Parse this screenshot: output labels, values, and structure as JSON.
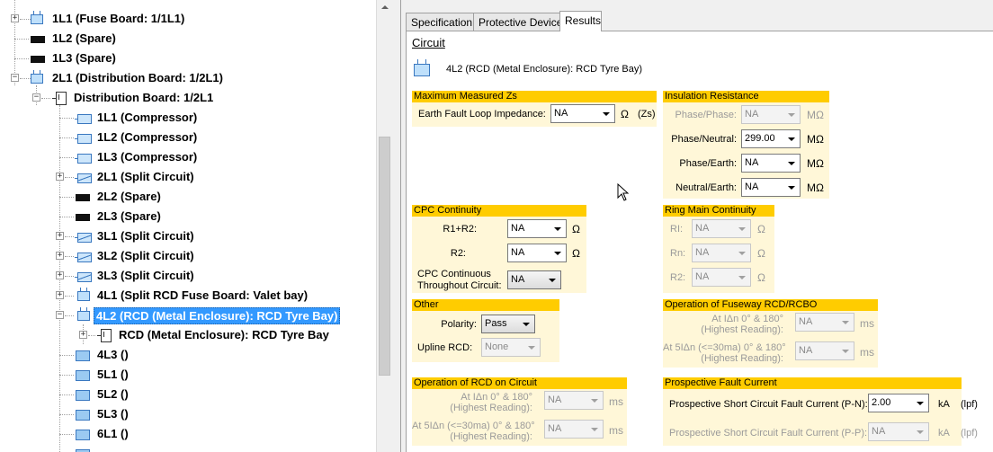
{
  "tree": {
    "items": [
      {
        "label": "1L1 (Fuse Board: 1/1L1)",
        "icon": "board-icon"
      },
      {
        "label": "1L2 (Spare)",
        "icon": "spare-icon"
      },
      {
        "label": "1L3 (Spare)",
        "icon": "spare-icon"
      },
      {
        "label": "2L1 (Distribution Board: 1/2L1)",
        "icon": "board-icon"
      },
      {
        "label": "Distribution Board: 1/2L1",
        "icon": "distribution-board-icon"
      },
      {
        "label": "1L1 (Compressor)",
        "icon": "circuit-icon"
      },
      {
        "label": "1L2 (Compressor)",
        "icon": "circuit-icon"
      },
      {
        "label": "1L3 (Compressor)",
        "icon": "circuit-icon"
      },
      {
        "label": "2L1 (Split Circuit)",
        "icon": "split-circuit-icon"
      },
      {
        "label": "2L2 (Spare)",
        "icon": "spare-icon"
      },
      {
        "label": "2L3 (Spare)",
        "icon": "spare-icon"
      },
      {
        "label": "3L1 (Split Circuit)",
        "icon": "split-circuit-icon"
      },
      {
        "label": "3L2 (Split Circuit)",
        "icon": "split-circuit-icon"
      },
      {
        "label": "3L3 (Split Circuit)",
        "icon": "split-circuit-icon"
      },
      {
        "label": "4L1 (Split RCD Fuse Board: Valet bay)",
        "icon": "board-icon"
      },
      {
        "label": "4L2 (RCD (Metal Enclosure): RCD Tyre Bay)",
        "icon": "board-icon"
      },
      {
        "label": "RCD (Metal Enclosure): RCD Tyre Bay",
        "icon": "distribution-board-icon"
      },
      {
        "label": "4L3 ()",
        "icon": "circuit-plain-icon"
      },
      {
        "label": "5L1 ()",
        "icon": "circuit-plain-icon"
      },
      {
        "label": "5L2 ()",
        "icon": "circuit-plain-icon"
      },
      {
        "label": "5L3 ()",
        "icon": "circuit-plain-icon"
      },
      {
        "label": "6L1 ()",
        "icon": "circuit-plain-icon"
      }
    ]
  },
  "tabs": [
    "Specification",
    "Protective Device",
    "Results"
  ],
  "active_tab": "Results",
  "circuit": {
    "link": "Circuit",
    "title": "4L2 (RCD (Metal Enclosure): RCD Tyre Bay)"
  },
  "max_zs": {
    "header": "Maximum Measured Zs",
    "label": "Earth Fault Loop Impedance:",
    "value": "NA",
    "unit": "Ω",
    "suffix": "(Zs)"
  },
  "insulation": {
    "header": "Insulation Resistance",
    "unit": "MΩ",
    "rows": [
      {
        "label": "Phase/Phase:",
        "value": "NA",
        "disabled": true
      },
      {
        "label": "Phase/Neutral:",
        "value": "299.00",
        "disabled": false
      },
      {
        "label": "Phase/Earth:",
        "value": "NA",
        "disabled": false
      },
      {
        "label": "Neutral/Earth:",
        "value": "NA",
        "disabled": false
      }
    ]
  },
  "cpc": {
    "header": "CPC Continuity",
    "unit": "Ω",
    "r1r2_label": "R1+R2:",
    "r1r2_value": "NA",
    "r2_label": "R2:",
    "r2_value": "NA",
    "continuous_label_1": "CPC Continuous",
    "continuous_label_2": "Throughout Circuit:",
    "continuous_value": "NA"
  },
  "ring": {
    "header": "Ring Main Continuity",
    "unit": "Ω",
    "rows": [
      {
        "label": "RI:",
        "value": "NA"
      },
      {
        "label": "Rn:",
        "value": "NA"
      },
      {
        "label": "R2:",
        "value": "NA"
      }
    ]
  },
  "other": {
    "header": "Other",
    "polarity_label": "Polarity:",
    "polarity_value": "Pass",
    "upline_label": "Upline RCD:",
    "upline_value": "None"
  },
  "fuseway_rcd": {
    "header": "Operation of Fuseway RCD/RCBO",
    "row1_label_1": "At IΔn 0° & 180°",
    "row1_label_2": "(Highest Reading):",
    "row1_value": "NA",
    "row2_label_1": "At 5IΔn (<=30ma) 0° & 180°",
    "row2_label_2": "(Highest Reading):",
    "row2_value": "NA",
    "unit": "ms"
  },
  "circuit_rcd": {
    "header": "Operation of RCD on Circuit",
    "row1_label_1": "At IΔn 0° & 180°",
    "row1_label_2": "(Highest Reading):",
    "row1_value": "NA",
    "row2_label_1": "At 5IΔn (<=30ma) 0° & 180°",
    "row2_label_2": "(Highest Reading):",
    "row2_value": "NA",
    "unit": "ms"
  },
  "pfc": {
    "header": "Prospective Fault Current",
    "pn_label": "Prospective Short Circuit Fault Current (P-N):",
    "pn_value": "2.00",
    "pp_label": "Prospective Short Circuit Fault Current (P-P):",
    "pp_value": "NA",
    "unit": "kA",
    "suffix": "(lpf)"
  },
  "colors": {
    "group_header": "#ffcc00",
    "group_body": "#fff7d8",
    "selection": "#3399ff"
  }
}
